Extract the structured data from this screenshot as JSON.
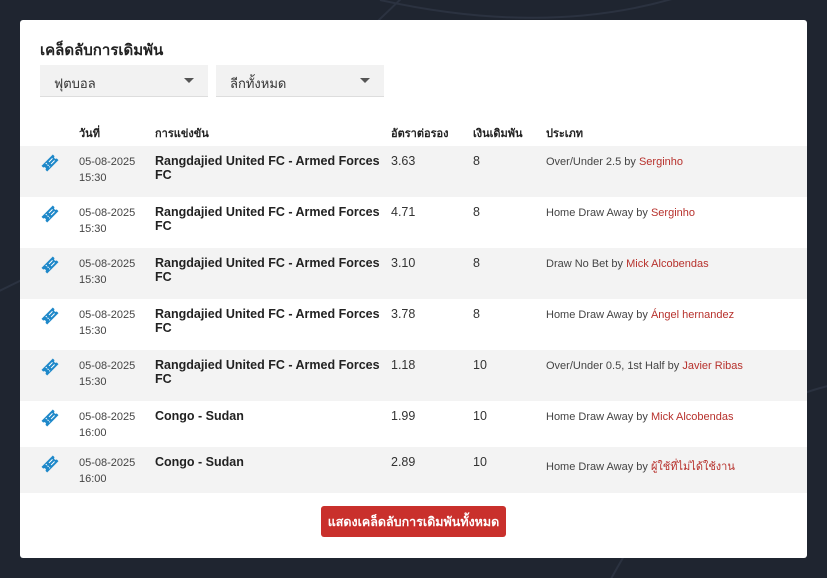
{
  "page": {
    "title": "เคล็ดลับการเดิมพัน"
  },
  "filters": {
    "sport": "ฟุตบอล",
    "league": "ลีกทั้งหมด"
  },
  "table": {
    "headers": {
      "date": "วันที่",
      "match": "การแข่งขัน",
      "odds": "อัตราต่อรอง",
      "stake": "เงินเดิมพัน",
      "type": "ประเภท"
    },
    "by_word": "by",
    "rows": [
      {
        "date": "05-08-2025",
        "time": "15:30",
        "match": "Rangdajied United FC - Armed Forces FC",
        "odds": "3.63",
        "stake": "8",
        "type": "Over/Under 2.5",
        "tipster": "Serginho"
      },
      {
        "date": "05-08-2025",
        "time": "15:30",
        "match": "Rangdajied United FC - Armed Forces FC",
        "odds": "4.71",
        "stake": "8",
        "type": "Home Draw Away",
        "tipster": "Serginho"
      },
      {
        "date": "05-08-2025",
        "time": "15:30",
        "match": "Rangdajied United FC - Armed Forces FC",
        "odds": "3.10",
        "stake": "8",
        "type": "Draw No Bet",
        "tipster": "Mick Alcobendas"
      },
      {
        "date": "05-08-2025",
        "time": "15:30",
        "match": "Rangdajied United FC - Armed Forces FC",
        "odds": "3.78",
        "stake": "8",
        "type": "Home Draw Away",
        "tipster": "Ángel hernandez"
      },
      {
        "date": "05-08-2025",
        "time": "15:30",
        "match": "Rangdajied United FC - Armed Forces FC",
        "odds": "1.18",
        "stake": "10",
        "type": "Over/Under 0.5, 1st Half",
        "tipster": "Javier Ribas"
      },
      {
        "date": "05-08-2025",
        "time": "16:00",
        "match": "Congo - Sudan",
        "odds": "1.99",
        "stake": "10",
        "type": "Home Draw Away",
        "tipster": "Mick Alcobendas"
      },
      {
        "date": "05-08-2025",
        "time": "16:00",
        "match": "Congo - Sudan",
        "odds": "2.89",
        "stake": "10",
        "type": "Home Draw Away",
        "tipster": "ผู้ใช้ที่ไม่ได้ใช้งาน"
      }
    ]
  },
  "show_all_button": "แสดงเคล็ดลับการเดิมพันทั้งหมด",
  "colors": {
    "accent": "#c9302c",
    "link": "#b7312c",
    "ticket_icon": "#1e88c9",
    "background": "#1f2530"
  },
  "icons": {
    "ticket": "ticket-icon",
    "dropdown": "chevron-down-icon"
  }
}
